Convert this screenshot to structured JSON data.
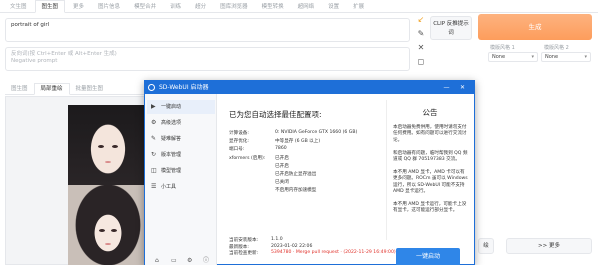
{
  "topnav": {
    "tabs": [
      "文生图",
      "图生图",
      "更多",
      "图片信息",
      "模型合并",
      "训练",
      "超分",
      "图库浏览器",
      "模型转换",
      "超网络",
      "设置",
      "扩展"
    ]
  },
  "prompt": {
    "value": "portrait of girl",
    "negative_placeholder": "反向词(按 Ctrl+Enter 或 Alt+Enter 生成)\nNegative prompt"
  },
  "clip_button": "CLIP 反推提示词",
  "generate_button": "生成",
  "styles": {
    "label1": "模版风格 1",
    "label2": "模版风格 2",
    "value1": "None",
    "value2": "None"
  },
  "subtabs": [
    "图生图",
    "局部重绘",
    "批量图生图"
  ],
  "gallery_buttons": {
    "send": "绘",
    "more": ">> 更多"
  },
  "launcher": {
    "title": "SD-WebUI 启动器",
    "sidebar": [
      {
        "icon": "▶",
        "label": "一键启动"
      },
      {
        "icon": "⚙",
        "label": "高级选项"
      },
      {
        "icon": "✎",
        "label": "疑难解答"
      },
      {
        "icon": "↻",
        "label": "版本管理"
      },
      {
        "icon": "◫",
        "label": "模型管理"
      },
      {
        "icon": "☰",
        "label": "小工具"
      }
    ],
    "heading": "已为您自动选择最佳配置项:",
    "config": [
      {
        "key": "计算设备:",
        "value": "0: NVIDIA GeForce GTX 1660 (6 GB)"
      },
      {
        "key": "显存优化:",
        "value": "中等显存 (6 GB 以上)"
      },
      {
        "key": "端口号:",
        "value": "7860"
      },
      {
        "key": "xformers (启用):",
        "value": "已开启"
      },
      {
        "key": "",
        "value": "已开启"
      },
      {
        "key": "",
        "value": "已开启防止显存溢出"
      },
      {
        "key": "",
        "value": "已关闭"
      },
      {
        "key": "",
        "value": "不启用内存加速模型"
      }
    ],
    "footer": [
      {
        "key": "当前安装版本:",
        "value": "1.1.0"
      },
      {
        "key": "最新版本:",
        "value": "2023-01-02 22:06"
      },
      {
        "key": "当前检查更新:",
        "value": "5394780 · Merge pull request · (2022-11-29 16:49:00)"
      }
    ],
    "notice_title": "公告",
    "notice_text": "本启动器免费供用，使用时请勿支付任何费用。如有问题可以进行交流讨论。\n\n和启动器有问题，临时帮我到 QQ 频道或 QQ 群 705197383 交流。\n\n本不用 AMD 显卡，AMD 卡可以有更多问题。ROCm 虽可以 Windows 运行，所以 SD-WebUI 可能不支持 AMD 显卡运行。\n\n本不用 AMD 显卡运行，可能卡上没有显卡，这可能运行部分显卡。",
    "launch_button": "一键启动"
  }
}
